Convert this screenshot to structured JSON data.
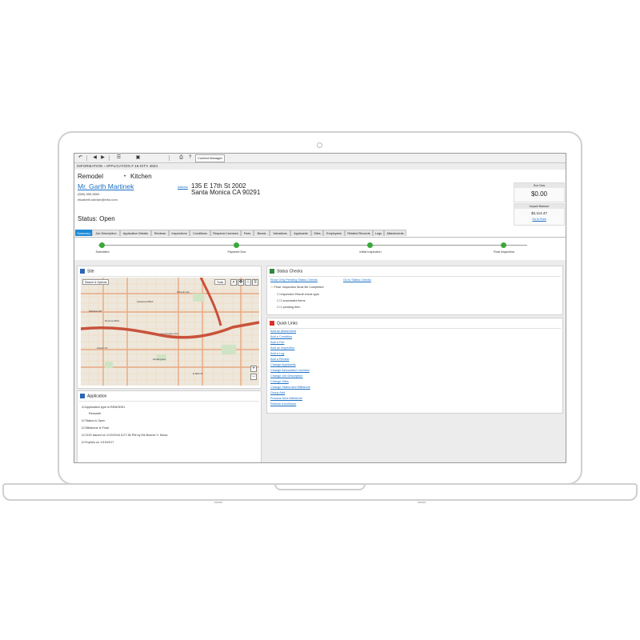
{
  "breadcrumb": "INFORMATION › APPLICATION # 16-KITV 4834",
  "toolbar": {
    "content_manager": "Content Manager",
    "icons": [
      "back-arrow-icon",
      "prev-icon",
      "next-icon",
      "list-icon",
      "view-icon",
      "print-icon",
      "help-icon"
    ]
  },
  "record": {
    "type": "Remodel",
    "subtype": "Kitchen",
    "contact_name": "Mr. Garth Martinek",
    "phone": "(555) 555-5554",
    "email": "elizabeth.shinkle@infor.com",
    "address_label": "Address",
    "address_line1": "135 E 17th St 2002",
    "address_line2": "Santa Monica CA 90291",
    "status": "Status:  Open"
  },
  "fees": {
    "due_now_label": "Due Now",
    "due_now_value": "$0.00",
    "unpaid_label": "Unpaid Balance",
    "unpaid_value": "$2,114.47",
    "go_to_fees": "Go to Fees"
  },
  "tabs": [
    "Summary",
    "Job Description",
    "Application Details",
    "Reviews",
    "Inspections",
    "Conditions",
    "Required Licenses",
    "Fees",
    "Bonds",
    "Valuations",
    "Applicants",
    "Sites",
    "Employees",
    "Related Records",
    "Logs",
    "Attachments"
  ],
  "workflow": {
    "steps": [
      "Submitted",
      "Payment Due",
      "Initial Inspection",
      "Final Inspection"
    ]
  },
  "site_panel": {
    "title": "Site",
    "search_options": "Search & Options",
    "tools": "Tools",
    "street_labels": [
      "Sample Ave",
      "Lakewood Blvd",
      "Wardlow Rd",
      "Del Amo Blvd",
      "Los Angeles Ave",
      "Carson St",
      "Harding Ave",
      "E 66th St"
    ]
  },
  "application_panel": {
    "title": "Application",
    "items": [
      "Application type is REMODEL",
      "Remodel",
      "Status is Open",
      "Milestone is Final",
      "CDD issued on 1/19/2016 5:27:36 PM by Ms Bonnie V. Moua",
      "Expires on 1/19/2017"
    ]
  },
  "status_checks": {
    "title": "Status Checks",
    "show_pending": "Show Only Pending Status Checks",
    "go_to": "Go to Status Checks",
    "final_warning": "Final: Inspection Must Be Completed",
    "sub_items": [
      "Inspection Result check type",
      "2 successful items",
      "1 pending item"
    ]
  },
  "quick_links": {
    "title": "Quick Links",
    "links": [
      "Add an Attachment",
      "Add a Condition",
      "Add a Fee",
      "Add an Inspection",
      "Add a Log",
      "Add a Review",
      "Change Applicants",
      "Change Associated Licenses",
      "Change Job Description",
      "Change Sites",
      "Change Status and Milestone",
      "Group Add",
      "Process Next Milestone",
      "Refresh InfoViewer"
    ]
  }
}
